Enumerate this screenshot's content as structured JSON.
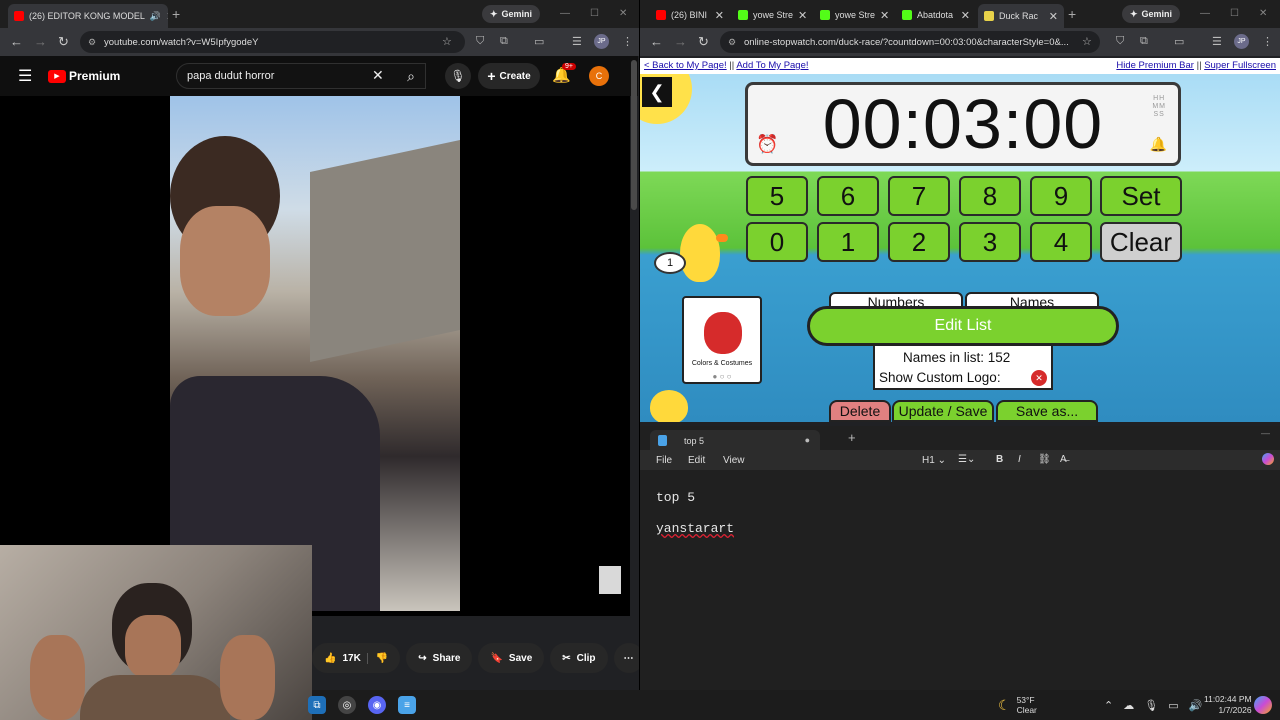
{
  "left_browser": {
    "tabs": [
      {
        "title": "(26) EDITOR KONG MODEL",
        "active": true
      }
    ],
    "gemini_label": "Gemini",
    "url": "youtube.com/watch?v=W5IpfygodeY"
  },
  "youtube": {
    "premium_label": "Premium",
    "search_value": "papa dudut horror",
    "create_label": "Create",
    "notif_badge": "9+",
    "user_initial": "C",
    "likes": "17K",
    "share_label": "Share",
    "save_label": "Save",
    "clip_label": "Clip"
  },
  "right_browser": {
    "tabs": [
      {
        "title": "(26) BINI",
        "active": false
      },
      {
        "title": "yowe Stre",
        "active": false
      },
      {
        "title": "yowe Stre",
        "active": false
      },
      {
        "title": "Abatdota",
        "active": false
      },
      {
        "title": "Duck Rac",
        "active": true
      }
    ],
    "gemini_label": "Gemini",
    "url": "online-stopwatch.com/duck-race/?countdown=00:03:00&characterStyle=0&..."
  },
  "stopwatch": {
    "premium_bar": {
      "back_link": "< Back to My Page!",
      "sep": "||",
      "add_link": "Add To My Page!",
      "hide_link": "Hide Premium Bar",
      "fullscreen_link": "Super Fullscreen"
    },
    "timer": "00:03:00",
    "hms": [
      "HH",
      "MM",
      "SS"
    ],
    "keys_row1": [
      "5",
      "6",
      "7",
      "8",
      "9"
    ],
    "keys_row2": [
      "0",
      "1",
      "2",
      "3",
      "4"
    ],
    "set_label": "Set",
    "clear_label": "Clear",
    "tab_numbers": "Numbers",
    "tab_names": "Names",
    "edit_list": "Edit List",
    "names_in_list": "Names in list: 152",
    "custom_logo": "Show Custom Logo:",
    "delete_label": "Delete",
    "update_label": "Update / Save",
    "save_as_label": "Save as...",
    "card_caption": "Colors & Costumes",
    "duck_number": "1"
  },
  "notepad": {
    "tab_title": "top 5",
    "menu": [
      "File",
      "Edit",
      "View"
    ],
    "heading_select": "H1",
    "lines": [
      "top 5",
      "",
      "yanstarart"
    ]
  },
  "taskbar": {
    "temp": "53°F",
    "weather": "Clear",
    "time": "11:02:44 PM",
    "date": "1/7/2026"
  },
  "colors": {
    "yt_red": "#ff0000",
    "stopwatch_green": "#7bd12e",
    "link_blue": "#1a0dab"
  }
}
